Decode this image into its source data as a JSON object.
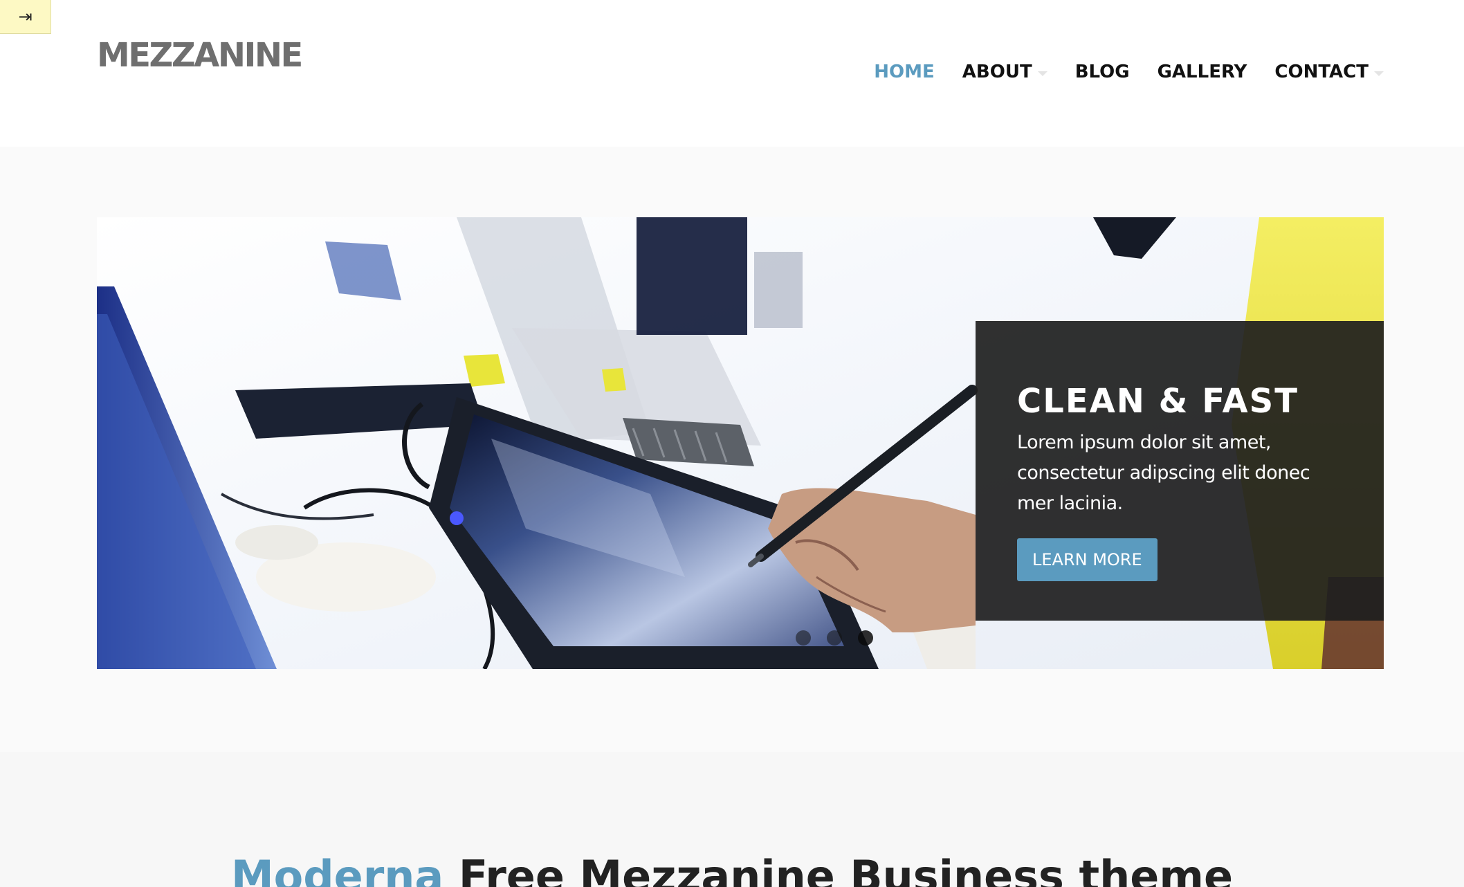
{
  "toggle": {
    "icon": "⇥"
  },
  "header": {
    "logo": "MEZZANINE",
    "nav": [
      {
        "label": "HOME",
        "active": true
      },
      {
        "label": "ABOUT",
        "has_dropdown": true
      },
      {
        "label": "BLOG"
      },
      {
        "label": "GALLERY"
      },
      {
        "label": "CONTACT",
        "has_dropdown": true
      }
    ]
  },
  "slider": {
    "image_icon": "office-tablet-photo",
    "caption": {
      "title": "CLEAN & FAST",
      "text": "Lorem ipsum dolor sit amet, consectetur adipscing elit donec mer lacinia.",
      "button": "LEARN MORE"
    },
    "dots": 3,
    "active_dot": 3
  },
  "intro": {
    "title_accent": "Moderna",
    "title_rest": " Free Mezzanine Business theme"
  },
  "colors": {
    "accent": "#5b9bbf",
    "logo": "#6f6f6f",
    "caption_bg": "#1e1e1e",
    "toggle_bg": "#fdf9c4"
  }
}
